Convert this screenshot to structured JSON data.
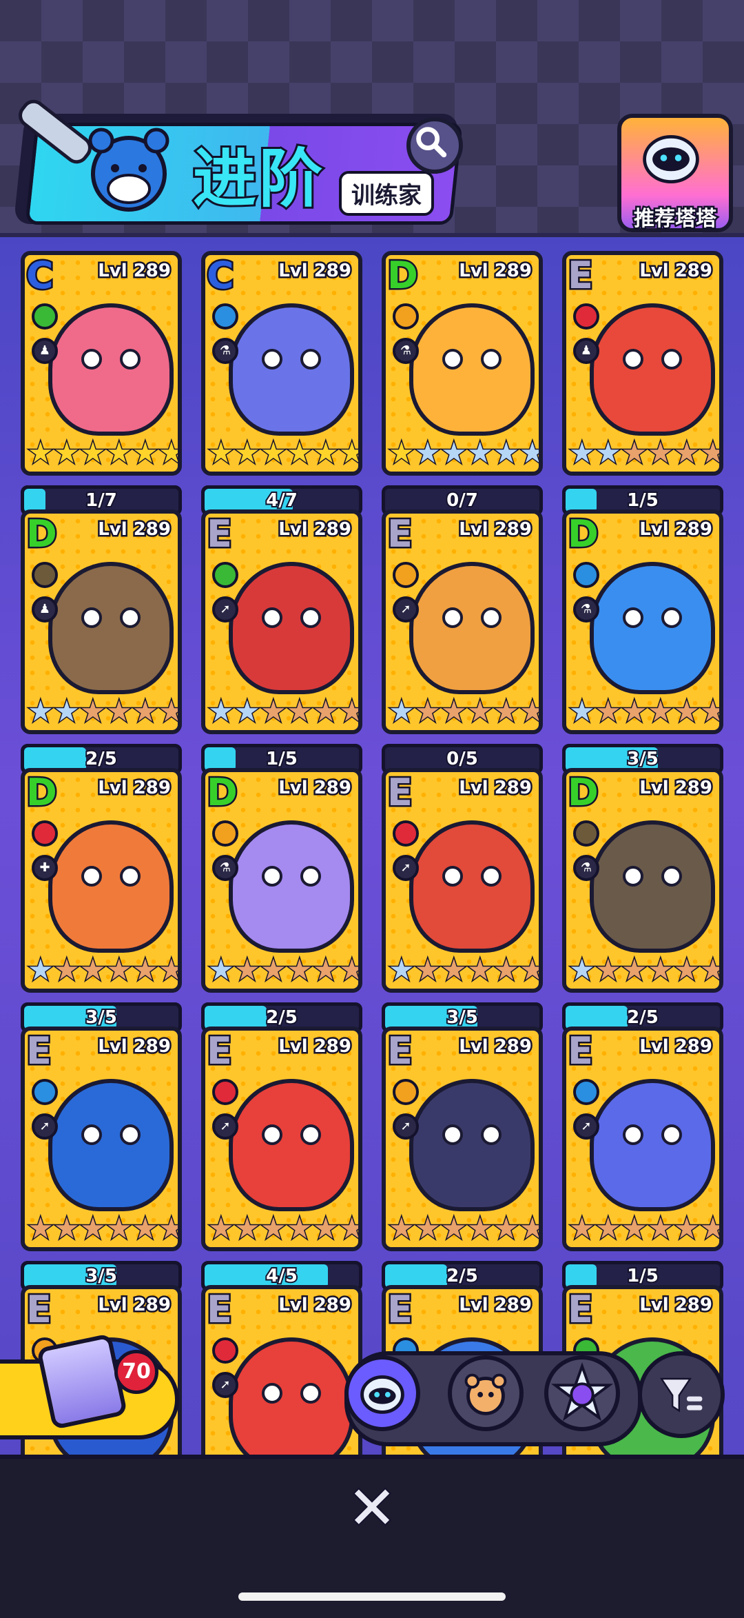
{
  "header": {
    "title": "进阶",
    "subtitle": "训练家",
    "search_icon": "search-icon",
    "recommend_label": "推荐塔塔"
  },
  "colors": {
    "card_gold": "#ffc62b",
    "progress_fill": "#34d4f0",
    "background_purple": "#5a4cc9"
  },
  "cards": [
    {
      "grade": "C",
      "level": "Lvl 289",
      "element": "grass",
      "role": "ghost",
      "stars": {
        "gold": 6,
        "silver": 0,
        "bronze": 0
      },
      "progress": "1/7",
      "fill": 0.14,
      "art": "#f06a8a"
    },
    {
      "grade": "C",
      "level": "Lvl 289",
      "element": "water",
      "role": "potion",
      "stars": {
        "gold": 6,
        "silver": 0,
        "bronze": 0
      },
      "progress": "4/7",
      "fill": 0.57,
      "art": "#6a74e8"
    },
    {
      "grade": "D",
      "level": "Lvl 289",
      "element": "elec",
      "role": "potion",
      "stars": {
        "gold": 1,
        "silver": 5,
        "bronze": 0
      },
      "progress": "0/7",
      "fill": 0,
      "art": "#ffb23a"
    },
    {
      "grade": "E",
      "level": "Lvl 289",
      "element": "fire",
      "role": "ghost",
      "stars": {
        "gold": 0,
        "silver": 2,
        "bronze": 4
      },
      "progress": "1/5",
      "fill": 0.2,
      "art": "#e8493a"
    },
    {
      "grade": "D",
      "level": "Lvl 289",
      "element": "rock",
      "role": "ghost",
      "stars": {
        "gold": 0,
        "silver": 2,
        "bronze": 4
      },
      "progress": "2/5",
      "fill": 0.4,
      "art": "#8a6a4a"
    },
    {
      "grade": "E",
      "level": "Lvl 289",
      "element": "grass",
      "role": "runner",
      "stars": {
        "gold": 0,
        "silver": 2,
        "bronze": 4
      },
      "progress": "1/5",
      "fill": 0.2,
      "art": "#d83a3a"
    },
    {
      "grade": "E",
      "level": "Lvl 289",
      "element": "elec",
      "role": "runner",
      "stars": {
        "gold": 0,
        "silver": 1,
        "bronze": 5
      },
      "progress": "0/5",
      "fill": 0,
      "art": "#f0a040"
    },
    {
      "grade": "D",
      "level": "Lvl 289",
      "element": "water",
      "role": "potion",
      "stars": {
        "gold": 0,
        "silver": 1,
        "bronze": 5
      },
      "progress": "3/5",
      "fill": 0.6,
      "art": "#3a8ef0"
    },
    {
      "grade": "D",
      "level": "Lvl 289",
      "element": "fire",
      "role": "heal",
      "stars": {
        "gold": 0,
        "silver": 1,
        "bronze": 5
      },
      "progress": "3/5",
      "fill": 0.6,
      "art": "#f07a3a"
    },
    {
      "grade": "D",
      "level": "Lvl 289",
      "element": "elec",
      "role": "potion",
      "stars": {
        "gold": 0,
        "silver": 1,
        "bronze": 5
      },
      "progress": "2/5",
      "fill": 0.4,
      "art": "#a58af0"
    },
    {
      "grade": "E",
      "level": "Lvl 289",
      "element": "fire",
      "role": "runner",
      "stars": {
        "gold": 0,
        "silver": 1,
        "bronze": 5
      },
      "progress": "3/5",
      "fill": 0.6,
      "art": "#e24a3a"
    },
    {
      "grade": "D",
      "level": "Lvl 289",
      "element": "rock",
      "role": "potion",
      "stars": {
        "gold": 0,
        "silver": 1,
        "bronze": 5
      },
      "progress": "2/5",
      "fill": 0.4,
      "art": "#6a5a4a"
    },
    {
      "grade": "E",
      "level": "Lvl 289",
      "element": "water",
      "role": "runner",
      "stars": {
        "gold": 0,
        "silver": 0,
        "bronze": 6
      },
      "progress": "3/5",
      "fill": 0.6,
      "art": "#2a6ad8"
    },
    {
      "grade": "E",
      "level": "Lvl 289",
      "element": "fire",
      "role": "runner",
      "stars": {
        "gold": 0,
        "silver": 0,
        "bronze": 6
      },
      "progress": "4/5",
      "fill": 0.8,
      "art": "#e8403a"
    },
    {
      "grade": "E",
      "level": "Lvl 289",
      "element": "elec",
      "role": "runner",
      "stars": {
        "gold": 0,
        "silver": 0,
        "bronze": 6
      },
      "progress": "2/5",
      "fill": 0.4,
      "art": "#3a3a6a"
    },
    {
      "grade": "E",
      "level": "Lvl 289",
      "element": "water",
      "role": "runner",
      "stars": {
        "gold": 0,
        "silver": 0,
        "bronze": 6
      },
      "progress": "1/5",
      "fill": 0.2,
      "art": "#5a6ae8"
    },
    {
      "grade": "E",
      "level": "Lvl 289",
      "element": "elec",
      "role": "runner",
      "stars": {
        "gold": 0,
        "silver": 0,
        "bronze": 6
      },
      "progress": "",
      "fill": 0,
      "art": "#2a5ad0"
    },
    {
      "grade": "E",
      "level": "Lvl 289",
      "element": "fire",
      "role": "runner",
      "stars": {
        "gold": 0,
        "silver": 0,
        "bronze": 6
      },
      "progress": "",
      "fill": 0,
      "art": "#e8403a"
    },
    {
      "grade": "E",
      "level": "Lvl 289",
      "element": "water",
      "role": "runner",
      "stars": {
        "gold": 0,
        "silver": 0,
        "bronze": 6
      },
      "progress": "",
      "fill": 0,
      "art": "#3a7ae8"
    },
    {
      "grade": "E",
      "level": "Lvl 289",
      "element": "grass",
      "role": "runner",
      "stars": {
        "gold": 0,
        "silver": 0,
        "bronze": 6
      },
      "progress": "",
      "fill": 0,
      "art": "#4ab84a"
    }
  ],
  "toolbar": {
    "chest_count": "70",
    "tabs": [
      "tata-cat-icon",
      "tata-bear-icon",
      "tata-star-cat-icon"
    ],
    "filter_icon": "filter-icon"
  },
  "bottom": {
    "close_label": "✕"
  }
}
